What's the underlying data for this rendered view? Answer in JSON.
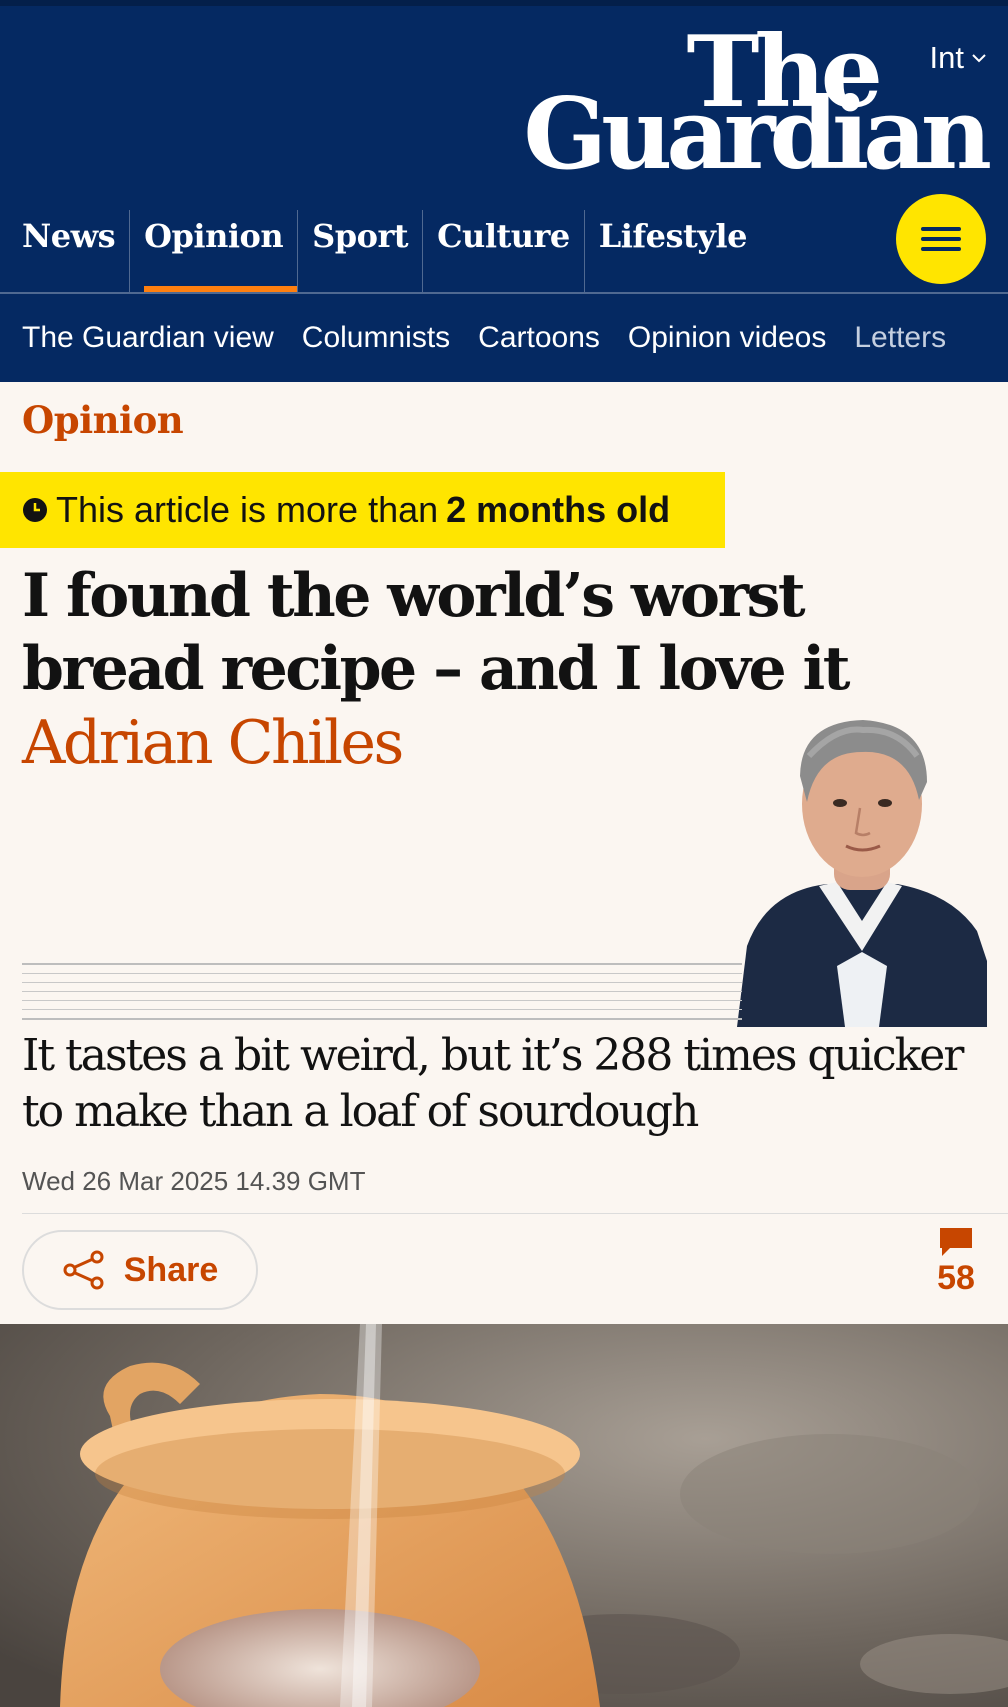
{
  "masthead": {
    "edition": "Int",
    "logo_line1": "The",
    "logo_line2": "Guardian",
    "pillars": [
      "News",
      "Opinion",
      "Sport",
      "Culture",
      "Lifestyle"
    ],
    "active_pillar": "Opinion",
    "menu_icon": "hamburger-icon",
    "colors": {
      "brand": "#052962",
      "accent": "#ff7f0f",
      "menu": "#ffe500"
    }
  },
  "subnav": {
    "items": [
      "The Guardian view",
      "Columnists",
      "Cartoons",
      "Opinion videos",
      "Letters"
    ]
  },
  "article": {
    "section": "Opinion",
    "age_notice_prefix": "This article is more than",
    "age_notice_bold": "2 months old",
    "headline": "I found the world’s worst bread recipe – and I love it",
    "author": "Adrian Chiles",
    "standfirst": "It tastes a bit weird, but it’s 288 times quicker to make than a loaf of sourdough",
    "date": "Wed 26 Mar 2025 14.39 GMT",
    "share_label": "Share",
    "comment_count": "58",
    "colors": {
      "opinion": "#c74600",
      "notice": "#ffe500"
    }
  }
}
